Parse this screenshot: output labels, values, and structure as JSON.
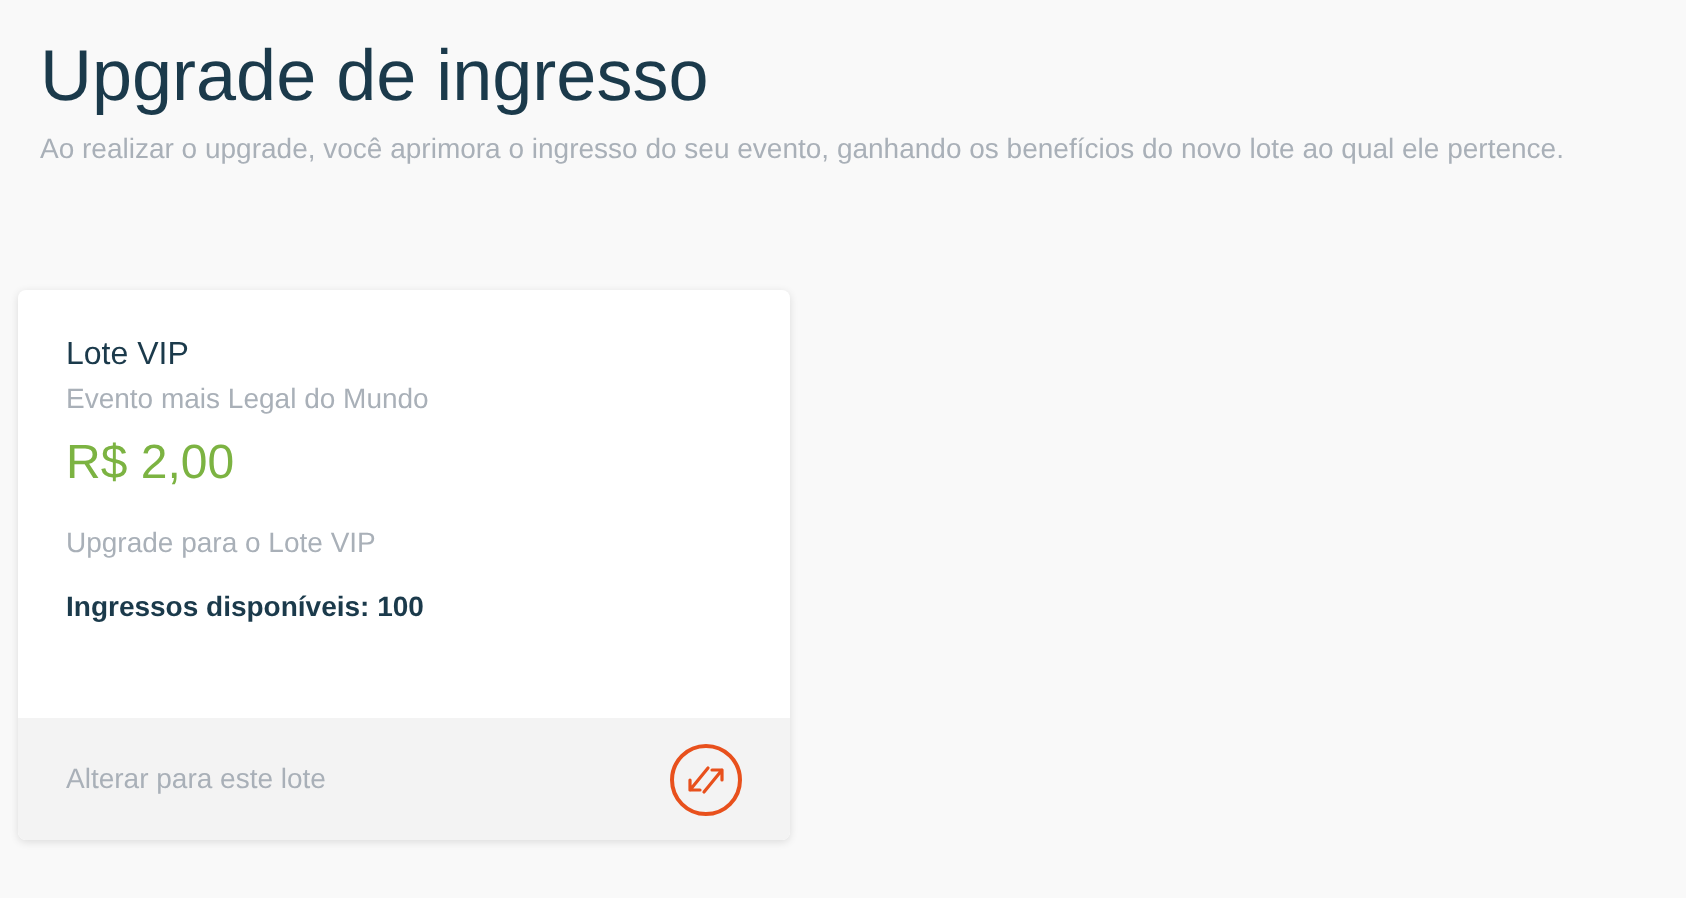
{
  "header": {
    "title": "Upgrade de ingresso",
    "subtitle": "Ao realizar o upgrade, você aprimora o ingresso do seu evento, ganhando os benefícios do novo lote ao qual ele pertence."
  },
  "lots": [
    {
      "name": "Lote VIP",
      "event": "Evento mais Legal do Mundo",
      "price": "R$ 2,00",
      "description": "Upgrade para o Lote VIP",
      "availability": "Ingressos disponíveis: 100",
      "action": "Alterar para este lote"
    }
  ]
}
